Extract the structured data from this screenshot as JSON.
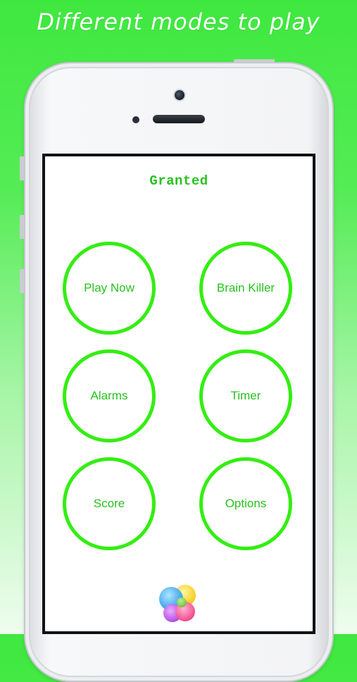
{
  "headline": "Different modes to play",
  "app": {
    "title": "Granted",
    "buttons": [
      {
        "id": "play-now",
        "label": "Play Now"
      },
      {
        "id": "brain-killer",
        "label": "Brain Killer"
      },
      {
        "id": "alarms",
        "label": "Alarms"
      },
      {
        "id": "timer",
        "label": "Timer"
      },
      {
        "id": "score",
        "label": "Score"
      },
      {
        "id": "options",
        "label": "Options"
      }
    ],
    "game_center_icon": "game-center-icon"
  },
  "colors": {
    "accent_green": "#33ee11",
    "text_green": "#27c21f",
    "background_green": "#3fe83f"
  }
}
